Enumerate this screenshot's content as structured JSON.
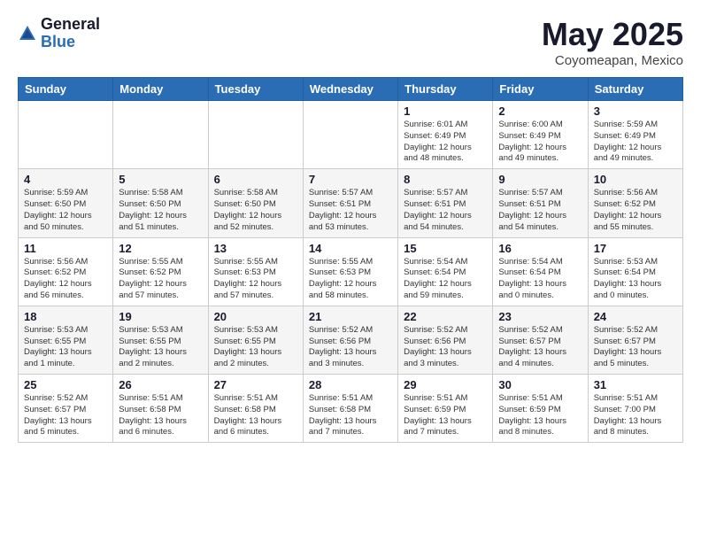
{
  "logo": {
    "general": "General",
    "blue": "Blue"
  },
  "title": "May 2025",
  "subtitle": "Coyomeapan, Mexico",
  "weekdays": [
    "Sunday",
    "Monday",
    "Tuesday",
    "Wednesday",
    "Thursday",
    "Friday",
    "Saturday"
  ],
  "weeks": [
    [
      {
        "day": "",
        "info": ""
      },
      {
        "day": "",
        "info": ""
      },
      {
        "day": "",
        "info": ""
      },
      {
        "day": "",
        "info": ""
      },
      {
        "day": "1",
        "info": "Sunrise: 6:01 AM\nSunset: 6:49 PM\nDaylight: 12 hours\nand 48 minutes."
      },
      {
        "day": "2",
        "info": "Sunrise: 6:00 AM\nSunset: 6:49 PM\nDaylight: 12 hours\nand 49 minutes."
      },
      {
        "day": "3",
        "info": "Sunrise: 5:59 AM\nSunset: 6:49 PM\nDaylight: 12 hours\nand 49 minutes."
      }
    ],
    [
      {
        "day": "4",
        "info": "Sunrise: 5:59 AM\nSunset: 6:50 PM\nDaylight: 12 hours\nand 50 minutes."
      },
      {
        "day": "5",
        "info": "Sunrise: 5:58 AM\nSunset: 6:50 PM\nDaylight: 12 hours\nand 51 minutes."
      },
      {
        "day": "6",
        "info": "Sunrise: 5:58 AM\nSunset: 6:50 PM\nDaylight: 12 hours\nand 52 minutes."
      },
      {
        "day": "7",
        "info": "Sunrise: 5:57 AM\nSunset: 6:51 PM\nDaylight: 12 hours\nand 53 minutes."
      },
      {
        "day": "8",
        "info": "Sunrise: 5:57 AM\nSunset: 6:51 PM\nDaylight: 12 hours\nand 54 minutes."
      },
      {
        "day": "9",
        "info": "Sunrise: 5:57 AM\nSunset: 6:51 PM\nDaylight: 12 hours\nand 54 minutes."
      },
      {
        "day": "10",
        "info": "Sunrise: 5:56 AM\nSunset: 6:52 PM\nDaylight: 12 hours\nand 55 minutes."
      }
    ],
    [
      {
        "day": "11",
        "info": "Sunrise: 5:56 AM\nSunset: 6:52 PM\nDaylight: 12 hours\nand 56 minutes."
      },
      {
        "day": "12",
        "info": "Sunrise: 5:55 AM\nSunset: 6:52 PM\nDaylight: 12 hours\nand 57 minutes."
      },
      {
        "day": "13",
        "info": "Sunrise: 5:55 AM\nSunset: 6:53 PM\nDaylight: 12 hours\nand 57 minutes."
      },
      {
        "day": "14",
        "info": "Sunrise: 5:55 AM\nSunset: 6:53 PM\nDaylight: 12 hours\nand 58 minutes."
      },
      {
        "day": "15",
        "info": "Sunrise: 5:54 AM\nSunset: 6:54 PM\nDaylight: 12 hours\nand 59 minutes."
      },
      {
        "day": "16",
        "info": "Sunrise: 5:54 AM\nSunset: 6:54 PM\nDaylight: 13 hours\nand 0 minutes."
      },
      {
        "day": "17",
        "info": "Sunrise: 5:53 AM\nSunset: 6:54 PM\nDaylight: 13 hours\nand 0 minutes."
      }
    ],
    [
      {
        "day": "18",
        "info": "Sunrise: 5:53 AM\nSunset: 6:55 PM\nDaylight: 13 hours\nand 1 minute."
      },
      {
        "day": "19",
        "info": "Sunrise: 5:53 AM\nSunset: 6:55 PM\nDaylight: 13 hours\nand 2 minutes."
      },
      {
        "day": "20",
        "info": "Sunrise: 5:53 AM\nSunset: 6:55 PM\nDaylight: 13 hours\nand 2 minutes."
      },
      {
        "day": "21",
        "info": "Sunrise: 5:52 AM\nSunset: 6:56 PM\nDaylight: 13 hours\nand 3 minutes."
      },
      {
        "day": "22",
        "info": "Sunrise: 5:52 AM\nSunset: 6:56 PM\nDaylight: 13 hours\nand 3 minutes."
      },
      {
        "day": "23",
        "info": "Sunrise: 5:52 AM\nSunset: 6:57 PM\nDaylight: 13 hours\nand 4 minutes."
      },
      {
        "day": "24",
        "info": "Sunrise: 5:52 AM\nSunset: 6:57 PM\nDaylight: 13 hours\nand 5 minutes."
      }
    ],
    [
      {
        "day": "25",
        "info": "Sunrise: 5:52 AM\nSunset: 6:57 PM\nDaylight: 13 hours\nand 5 minutes."
      },
      {
        "day": "26",
        "info": "Sunrise: 5:51 AM\nSunset: 6:58 PM\nDaylight: 13 hours\nand 6 minutes."
      },
      {
        "day": "27",
        "info": "Sunrise: 5:51 AM\nSunset: 6:58 PM\nDaylight: 13 hours\nand 6 minutes."
      },
      {
        "day": "28",
        "info": "Sunrise: 5:51 AM\nSunset: 6:58 PM\nDaylight: 13 hours\nand 7 minutes."
      },
      {
        "day": "29",
        "info": "Sunrise: 5:51 AM\nSunset: 6:59 PM\nDaylight: 13 hours\nand 7 minutes."
      },
      {
        "day": "30",
        "info": "Sunrise: 5:51 AM\nSunset: 6:59 PM\nDaylight: 13 hours\nand 8 minutes."
      },
      {
        "day": "31",
        "info": "Sunrise: 5:51 AM\nSunset: 7:00 PM\nDaylight: 13 hours\nand 8 minutes."
      }
    ]
  ]
}
